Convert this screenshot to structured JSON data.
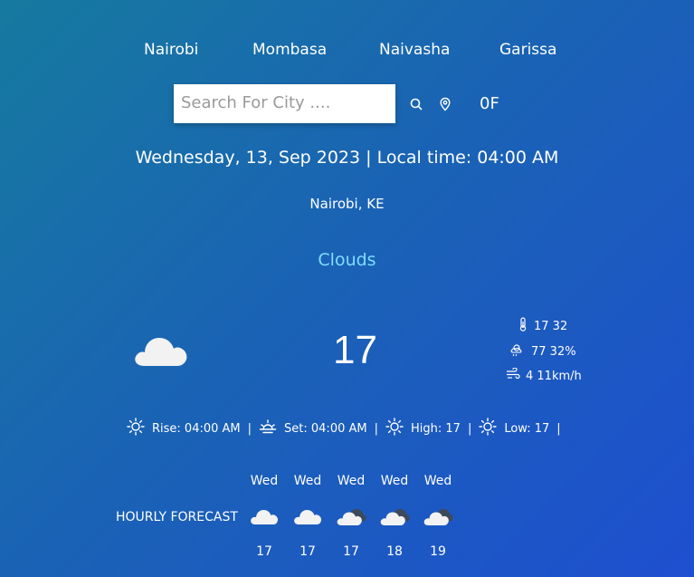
{
  "cities": [
    "Nairobi",
    "Mombasa",
    "Naivasha",
    "Garissa"
  ],
  "search": {
    "placeholder": "Search For City ...."
  },
  "unit_toggle": "0F",
  "date_line": "Wednesday, 13, Sep 2023 | Local time: 04:00 AM",
  "location": "Nairobi, KE",
  "condition": "Clouds",
  "current": {
    "icon": "cloud-icon",
    "temp": "17",
    "feels_like": "17 32",
    "humidity": "77 32%",
    "wind": "4 11km/h"
  },
  "sun": {
    "rise": "Rise: 04:00 AM",
    "set": "Set:  04:00 AM",
    "high": "High:  17",
    "low": "Low:  17",
    "separator": "|"
  },
  "hourly": {
    "label": "HOURLY FORECAST",
    "items": [
      {
        "day": "Wed",
        "temp": "17",
        "icon": "cloud-icon"
      },
      {
        "day": "Wed",
        "temp": "17",
        "icon": "cloud-icon"
      },
      {
        "day": "Wed",
        "temp": "17",
        "icon": "broken-clouds-icon"
      },
      {
        "day": "Wed",
        "temp": "18",
        "icon": "broken-clouds-icon"
      },
      {
        "day": "Wed",
        "temp": "19",
        "icon": "broken-clouds-icon"
      }
    ]
  },
  "colors": {
    "condition_text": "#7fdcff",
    "cloud_light": "#f2f2f2",
    "cloud_dark": "#3d4a5c"
  }
}
